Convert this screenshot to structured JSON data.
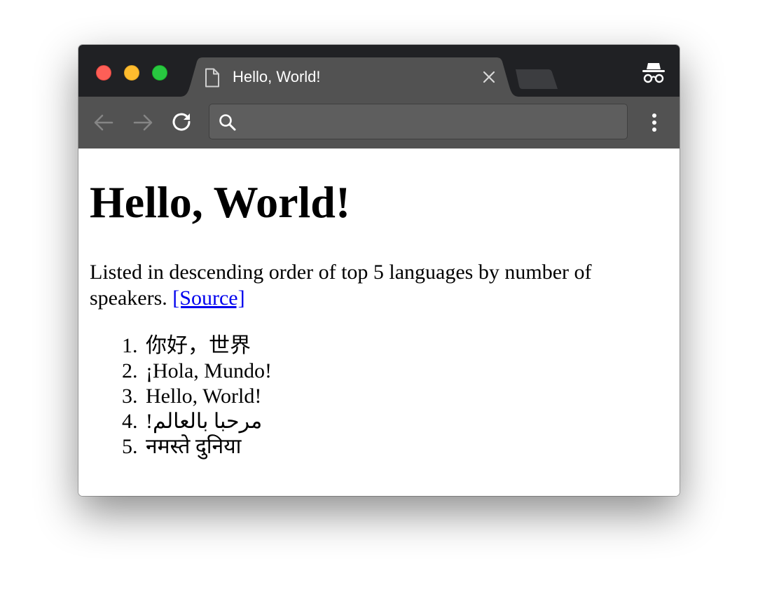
{
  "browser": {
    "tab": {
      "title": "Hello, World!",
      "icon": "document-icon"
    },
    "omnibox": {
      "value": "",
      "icon": "search-icon"
    },
    "icons": {
      "back": "arrow-left-icon",
      "forward": "arrow-right-icon",
      "reload": "reload-icon",
      "menu": "more-vertical-icon",
      "incognito": "incognito-icon",
      "close_tab": "close-icon"
    },
    "colors": {
      "titlebar": "#202124",
      "toolbar": "#525252",
      "omnibox": "#5e5e5e",
      "traffic_close": "#fe5f57",
      "traffic_minimize": "#febc2e",
      "traffic_maximize": "#28c840"
    }
  },
  "page": {
    "heading": "Hello, World!",
    "intro": "Listed in descending order of top 5 languages by number of speakers.",
    "source_link": "[Source]",
    "link_color": "#0000ee",
    "languages": [
      {
        "num": "1.",
        "text": "你好，世界"
      },
      {
        "num": "2.",
        "text": "¡Hola, Mundo!"
      },
      {
        "num": "3.",
        "text": "Hello, World!"
      },
      {
        "num": "4.",
        "text": "مرحبا بالعالم!"
      },
      {
        "num": "5.",
        "text": "नमस्ते दुनिया"
      }
    ]
  }
}
